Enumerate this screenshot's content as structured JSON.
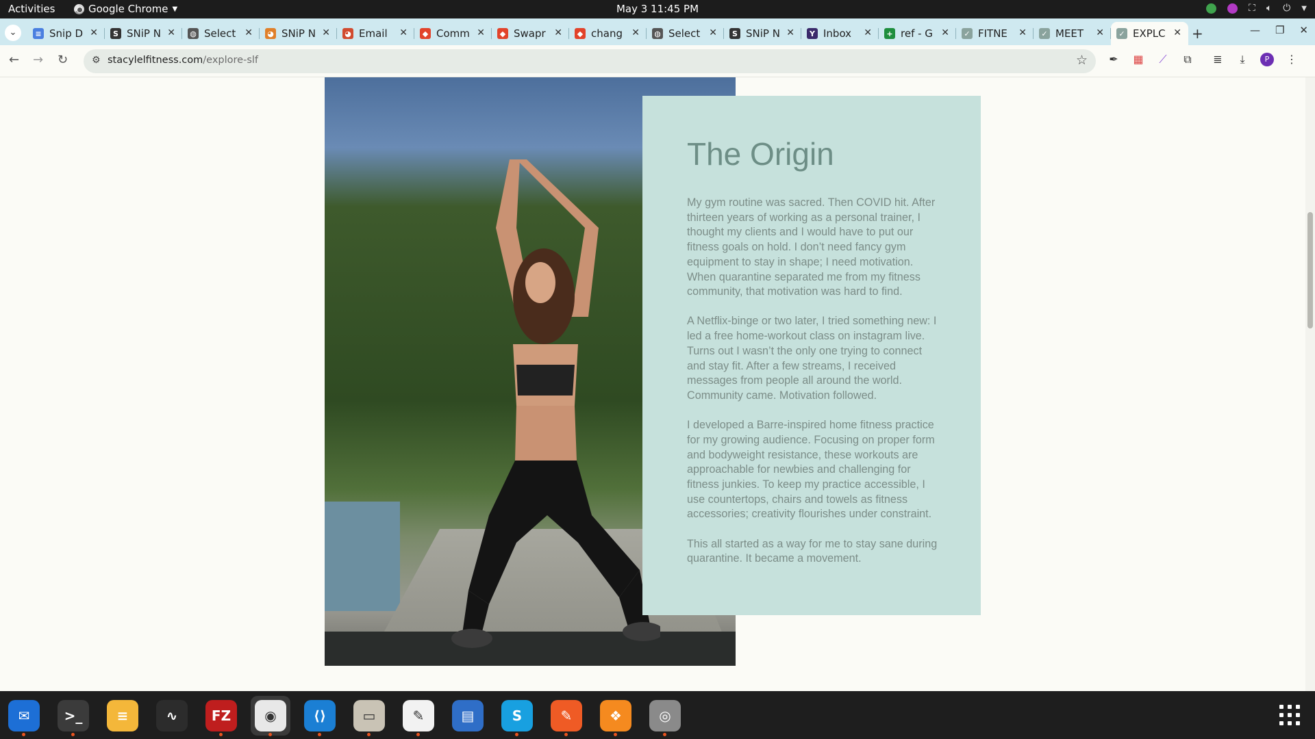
{
  "system_bar": {
    "activities": "Activities",
    "app_name": "Google Chrome",
    "clock": "May 3  11:45 PM"
  },
  "tabs": [
    {
      "label": "Snip D",
      "favicon": "docs-icon",
      "color": "#4a7fe0",
      "glyph": "≡"
    },
    {
      "label": "SNiP N",
      "favicon": "snip-icon",
      "color": "#333333",
      "glyph": "S"
    },
    {
      "label": "Select",
      "favicon": "globe-icon",
      "color": "#555555",
      "glyph": "◍"
    },
    {
      "label": "SNiP N",
      "favicon": "chrome-app-icon",
      "color": "#e0802a",
      "glyph": "◕"
    },
    {
      "label": "Email",
      "favicon": "chrome-app-icon",
      "color": "#d14b2f",
      "glyph": "◕"
    },
    {
      "label": "Comm",
      "favicon": "gitlab-icon",
      "color": "#e2432a",
      "glyph": "◆"
    },
    {
      "label": "Swapr",
      "favicon": "gitlab-icon",
      "color": "#e2432a",
      "glyph": "◆"
    },
    {
      "label": "chang",
      "favicon": "gitlab-icon",
      "color": "#e2432a",
      "glyph": "◆"
    },
    {
      "label": "Select",
      "favicon": "globe-icon",
      "color": "#555555",
      "glyph": "◍"
    },
    {
      "label": "SNiP N",
      "favicon": "snip-icon",
      "color": "#333333",
      "glyph": "S"
    },
    {
      "label": "Inbox",
      "favicon": "yahoo-icon",
      "color": "#3a2a6b",
      "glyph": "Y"
    },
    {
      "label": "ref - G",
      "favicon": "sheets-icon",
      "color": "#1e8e3e",
      "glyph": "+"
    },
    {
      "label": "FITNE",
      "favicon": "slf-icon",
      "color": "#8aa39d",
      "glyph": "✓"
    },
    {
      "label": "MEET",
      "favicon": "slf-icon",
      "color": "#8aa39d",
      "glyph": "✓"
    },
    {
      "label": "EXPLC",
      "favicon": "slf-icon",
      "color": "#8aa39d",
      "glyph": "✓",
      "active": true
    }
  ],
  "address_bar": {
    "domain": "stacylelfitness.com",
    "path": "/explore-slf"
  },
  "content": {
    "heading": "The Origin",
    "paragraphs": [
      "My gym routine was sacred. Then COVID hit. After thirteen years of working as a personal trainer, I thought my clients and I would have to put our fitness goals on hold. I don’t need fancy gym equipment to stay in shape; I need motivation. When quarantine separated me from my fitness community, that motivation was hard to find.",
      "A Netflix-binge or two later, I tried something new: I led a free home-workout class on instagram live. Turns out I wasn’t the only one trying to connect and stay fit. After a few streams, I received messages from people all around the world. Community came. Motivation followed.",
      "I developed a Barre-inspired home fitness practice for my growing audience. Focusing on proper form and bodyweight resistance, these workouts are approachable for newbies and challenging for fitness junkies. To keep my practice accessible, I use countertops, chairs and towels as fitness accessories; creativity flourishes under constraint.",
      "This all started as a way for me to stay sane during quarantine. It became a movement."
    ]
  },
  "dock": [
    {
      "name": "thunderbird-icon",
      "color": "#1d6fd6",
      "glyph": "✉",
      "running": true
    },
    {
      "name": "terminal-icon",
      "color": "#3b3b3b",
      "glyph": ">_",
      "running": true
    },
    {
      "name": "notes-icon",
      "color": "#f4b73a",
      "glyph": "≡",
      "running": false
    },
    {
      "name": "system-monitor-icon",
      "color": "#2c2c2c",
      "glyph": "∿",
      "running": false
    },
    {
      "name": "filezilla-icon",
      "color": "#bf1e1e",
      "glyph": "FZ",
      "running": true
    },
    {
      "name": "chrome-icon",
      "color": "#e8e8e8",
      "glyph": "◉",
      "running": true,
      "active": true
    },
    {
      "name": "vscode-icon",
      "color": "#1b7fd4",
      "glyph": "⟨⟩",
      "running": true
    },
    {
      "name": "files-icon",
      "color": "#c9c3b5",
      "glyph": "▭",
      "running": true
    },
    {
      "name": "text-editor-icon",
      "color": "#f2f2f2",
      "glyph": "✎",
      "running": true
    },
    {
      "name": "document-viewer-icon",
      "color": "#2f6ec7",
      "glyph": "▤",
      "running": false
    },
    {
      "name": "skype-icon",
      "color": "#18a0e0",
      "glyph": "S",
      "running": true
    },
    {
      "name": "postman-icon",
      "color": "#ef5b25",
      "glyph": "✎",
      "running": true
    },
    {
      "name": "blender-like-icon",
      "color": "#f58a1f",
      "glyph": "❖",
      "running": true
    },
    {
      "name": "disk-icon",
      "color": "#8a8a8a",
      "glyph": "◎",
      "running": true
    }
  ]
}
